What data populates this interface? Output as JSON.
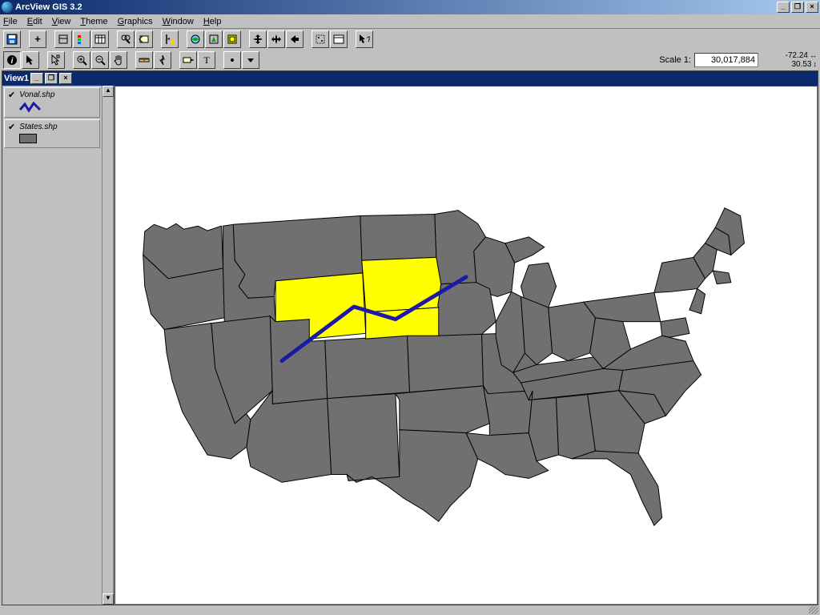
{
  "app": {
    "title": "ArcView GIS 3.2"
  },
  "mainWindowButtons": {
    "minimize": "_",
    "restore": "❐",
    "close": "×"
  },
  "menu": {
    "file": "File",
    "edit": "Edit",
    "view": "View",
    "theme": "Theme",
    "graphics": "Graphics",
    "window": "Window",
    "help": "Help"
  },
  "scale": {
    "label": "Scale 1:",
    "value": "30,017,884"
  },
  "coords": {
    "x": "-72.24",
    "y": "30.53"
  },
  "viewWindow": {
    "title": "View1"
  },
  "toc": {
    "themes": [
      {
        "name": "Vonal.shp",
        "checked": true,
        "type": "line"
      },
      {
        "name": "States.shp",
        "checked": true,
        "type": "polygon"
      }
    ]
  },
  "colors": {
    "highlight": "#ffff00",
    "stateFill": "#707070",
    "stateStroke": "#000000",
    "line": "#1a1aa6"
  }
}
